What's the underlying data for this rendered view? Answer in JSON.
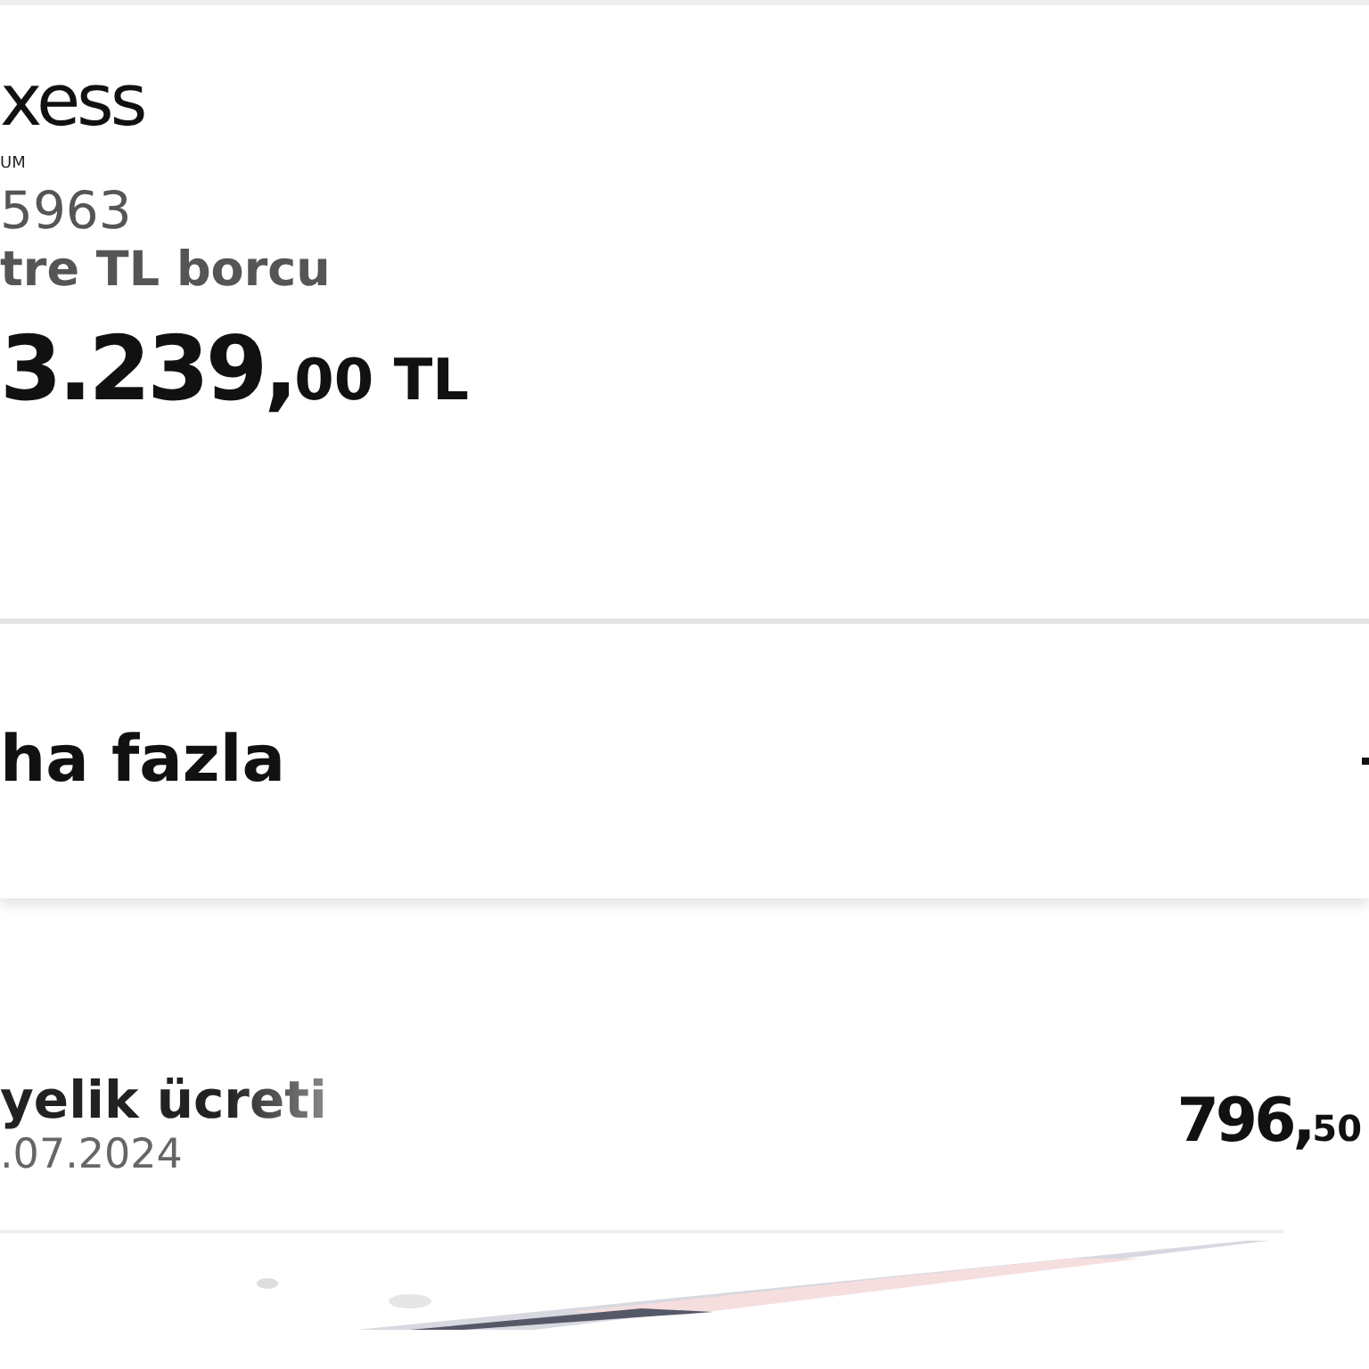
{
  "card": {
    "logo": "xess",
    "logo_subtitle": "UM",
    "card_number": "5963",
    "debt_label": "tre TL borcu",
    "debt_amount": {
      "main": "3.239,",
      "fraction": "00 TL"
    }
  },
  "more": {
    "label": "ha fazla"
  },
  "transactions": [
    {
      "title": "yelik ücreti",
      "date": ".07.2024",
      "amount": {
        "main": "796,",
        "fraction": "50"
      }
    }
  ]
}
